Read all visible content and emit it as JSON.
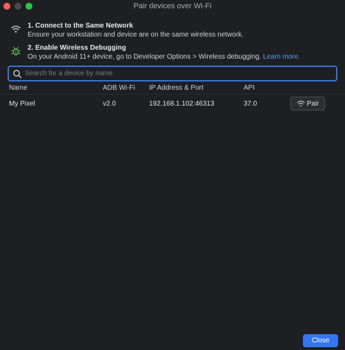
{
  "window": {
    "title": "Pair devices over Wi-Fi"
  },
  "steps": [
    {
      "heading": "1. Connect to the Same Network",
      "description": "Ensure your workstation and device are on the same wireless network.",
      "icon": "wifi-icon"
    },
    {
      "heading": "2. Enable Wireless Debugging",
      "description": "On your Android 11+ device, go to Developer Options > Wireless debugging.",
      "link_text": "Learn more.",
      "icon": "bug-icon"
    }
  ],
  "search": {
    "placeholder": "Search for a device by name",
    "value": ""
  },
  "table": {
    "columns": [
      "Name",
      "ADB Wi-Fi",
      "IP Address & Port",
      "API"
    ],
    "rows": [
      {
        "name": "My Pixel",
        "adb": "v2.0",
        "ip": "192.168.1.102:46313",
        "api": "37.0",
        "action": "Pair"
      }
    ]
  },
  "footer": {
    "close_label": "Close"
  },
  "colors": {
    "accent": "#3574f0",
    "link": "#589df6",
    "background": "#1e1f22"
  }
}
